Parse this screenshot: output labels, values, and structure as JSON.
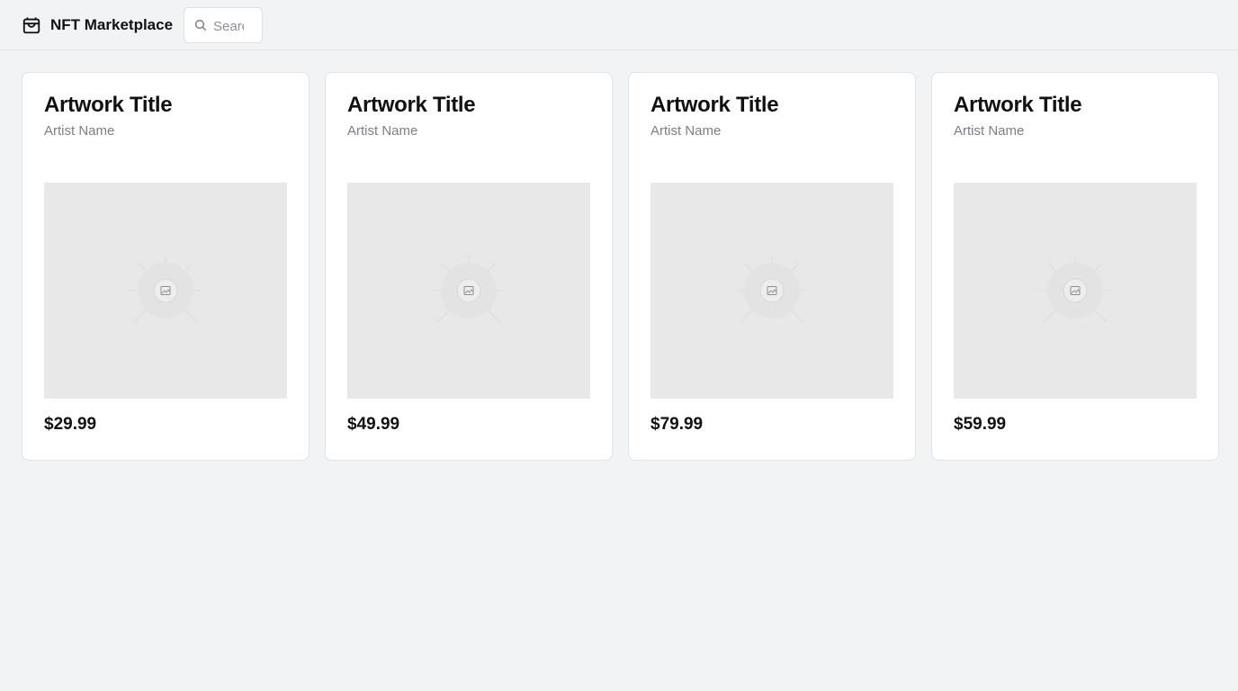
{
  "app": {
    "title": "NFT Marketplace",
    "icon": "shopping-bag-icon"
  },
  "search": {
    "placeholder": "Search",
    "value": "",
    "icon": "search-icon"
  },
  "cards": [
    {
      "title": "Artwork Title",
      "artist": "Artist Name",
      "price": "$29.99",
      "image_icon": "image-placeholder-icon"
    },
    {
      "title": "Artwork Title",
      "artist": "Artist Name",
      "price": "$49.99",
      "image_icon": "image-placeholder-icon"
    },
    {
      "title": "Artwork Title",
      "artist": "Artist Name",
      "price": "$79.99",
      "image_icon": "image-placeholder-icon"
    },
    {
      "title": "Artwork Title",
      "artist": "Artist Name",
      "price": "$59.99",
      "image_icon": "image-placeholder-icon"
    }
  ],
  "colors": {
    "background": "#f2f3f5",
    "card": "#ffffff",
    "image_placeholder": "#e8e8e8",
    "muted_text": "#7a7f87"
  }
}
